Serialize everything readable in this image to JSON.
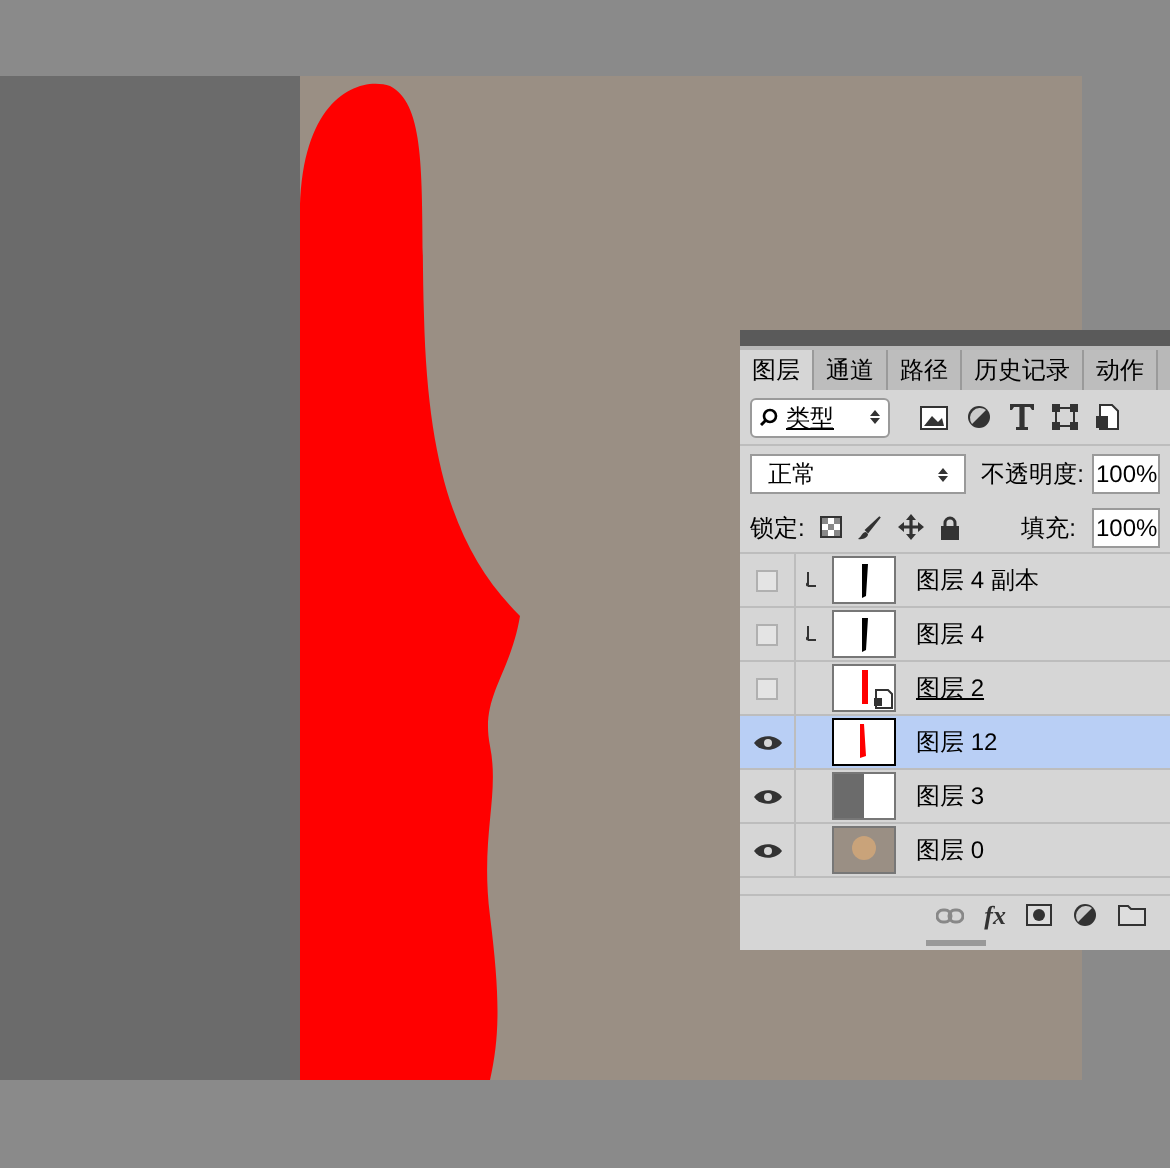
{
  "layers_panel": {
    "tabs": [
      {
        "label": "图层",
        "selected": true
      },
      {
        "label": "通道",
        "selected": false
      },
      {
        "label": "路径",
        "selected": false
      },
      {
        "label": "历史记录",
        "selected": false
      },
      {
        "label": "动作",
        "selected": false
      }
    ],
    "filter": {
      "label": "类型"
    },
    "blend_mode": "正常",
    "opacity_label": "不透明度:",
    "opacity": "100%",
    "lock_label": "锁定:",
    "fill_label": "填充:",
    "fill": "100%",
    "layers": [
      {
        "name": "图层 4 副本",
        "visible": false,
        "selected": false,
        "clipped": true,
        "kind": "stroke"
      },
      {
        "name": "图层 4",
        "visible": false,
        "selected": false,
        "clipped": true,
        "kind": "stroke"
      },
      {
        "name": "图层 2",
        "visible": false,
        "selected": false,
        "clipped": false,
        "kind": "smart"
      },
      {
        "name": "图层 12",
        "visible": true,
        "selected": true,
        "clipped": false,
        "kind": "red"
      },
      {
        "name": "图层 3",
        "visible": true,
        "selected": false,
        "clipped": false,
        "kind": "half"
      },
      {
        "name": "图层 0",
        "visible": true,
        "selected": false,
        "clipped": false,
        "kind": "photo"
      }
    ],
    "footer_fx": "fx"
  }
}
